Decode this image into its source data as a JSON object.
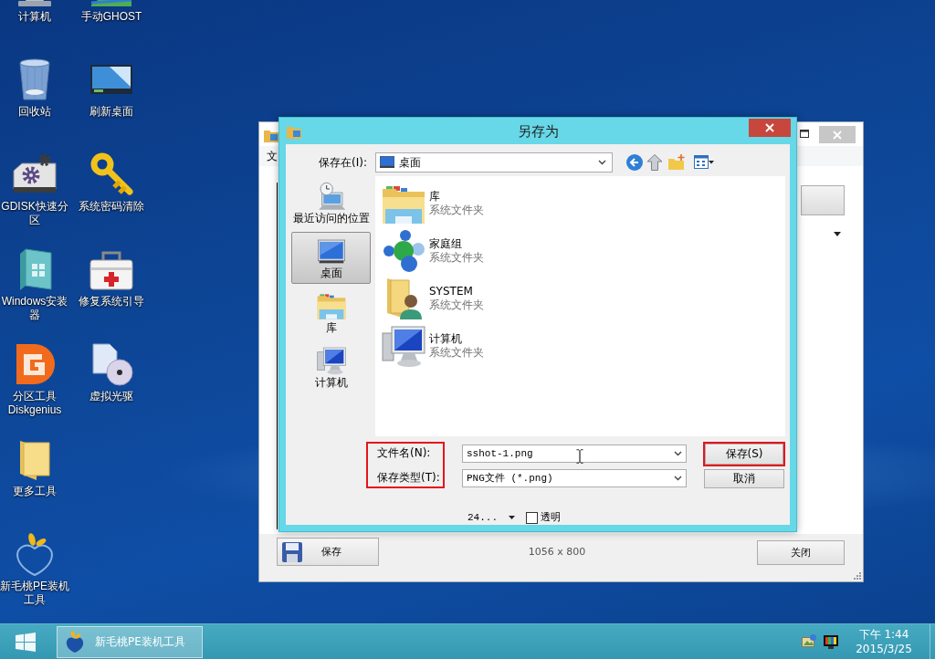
{
  "desktop": {
    "icons": [
      {
        "label": "计算机",
        "kind": "computer"
      },
      {
        "label": "回收站",
        "kind": "recycle_bin"
      },
      {
        "label": "GDISK快速分区",
        "kind": "gdisk"
      },
      {
        "label": "Windows安装器",
        "kind": "installer"
      },
      {
        "label": "分区工具 Diskgenius",
        "kind": "diskgenius"
      },
      {
        "label": "更多工具",
        "kind": "folder"
      },
      {
        "label": "新毛桃PE装机工具",
        "kind": "peach"
      },
      {
        "label": "手动GHOST",
        "kind": "ghost"
      },
      {
        "label": "刷新桌面",
        "kind": "refresh"
      },
      {
        "label": "系统密码清除",
        "kind": "key"
      },
      {
        "label": "修复系统引导",
        "kind": "repair"
      },
      {
        "label": "虚拟光驱",
        "kind": "virtual_drive"
      }
    ]
  },
  "background_window": {
    "menu": [
      "文"
    ],
    "save_button": "保存",
    "image_size": "1056 x 800",
    "close_button": "关闭"
  },
  "dialog": {
    "title": "另存为",
    "save_in": {
      "label": "保存在(I):",
      "value": "桌面"
    },
    "places": [
      {
        "label": "最近访问的位置",
        "kind": "recent",
        "selected": false
      },
      {
        "label": "桌面",
        "kind": "desktop",
        "selected": true
      },
      {
        "label": "库",
        "kind": "library",
        "selected": false
      },
      {
        "label": "计算机",
        "kind": "computer",
        "selected": false
      }
    ],
    "files": [
      {
        "name": "库",
        "type": "系统文件夹",
        "kind": "library"
      },
      {
        "name": "家庭组",
        "type": "系统文件夹",
        "kind": "homegroup"
      },
      {
        "name": "SYSTEM",
        "type": "系统文件夹",
        "kind": "user"
      },
      {
        "name": "计算机",
        "type": "系统文件夹",
        "kind": "computer"
      }
    ],
    "file_name": {
      "label": "文件名(N):",
      "value": "sshot-1.png"
    },
    "file_type": {
      "label": "保存类型(T):",
      "value": "PNG文件 (*.png)"
    },
    "save_button": "保存(S)",
    "cancel_button": "取消",
    "color_depth": "24...",
    "transparent": {
      "label": "透明",
      "checked": false
    }
  },
  "taskbar": {
    "items": [
      {
        "label": "新毛桃PE装机工具",
        "selected": true
      }
    ],
    "time": "下午 1:44",
    "date": "2015/3/25"
  }
}
